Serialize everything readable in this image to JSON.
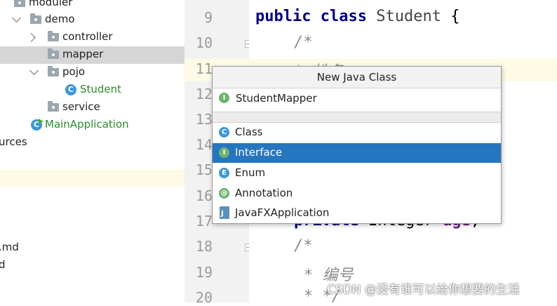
{
  "tree": {
    "items": [
      {
        "label": "moduler",
        "level": 1
      },
      {
        "label": "demo",
        "level": 2
      },
      {
        "label": "controller",
        "level": 3
      },
      {
        "label": "mapper",
        "level": 3
      },
      {
        "label": "pojo",
        "level": 3
      },
      {
        "label": "Student",
        "level": 4
      },
      {
        "label": "service",
        "level": 3
      },
      {
        "label": "MainApplication",
        "level": 2
      },
      {
        "label": "urces",
        "level": 0
      },
      {
        "label": ".md",
        "level": 0
      },
      {
        "label": "d",
        "level": 0
      }
    ],
    "selected": "mapper"
  },
  "gutter": {
    "line_numbers": [
      "9",
      "10",
      "11",
      "12",
      "13",
      "14",
      "15",
      "16",
      "17",
      "18",
      "19",
      "20"
    ]
  },
  "editor": {
    "line9": {
      "kw1": "public",
      "kw2": "class",
      "name": "Student",
      "brace": "{"
    },
    "line10": "/*",
    "line11": "* 姓名",
    "line17": {
      "kw": "private",
      "type": "Integer",
      "field": "age",
      "end": ";"
    },
    "line18": "/*",
    "line19": "* 编号",
    "line20": "* */"
  },
  "popup": {
    "title": "New Java Class",
    "name_value": "StudentMapper",
    "options": [
      {
        "label": "Class",
        "icon": "class-icon",
        "badge": "C"
      },
      {
        "label": "Interface",
        "icon": "interface-icon",
        "badge": "I"
      },
      {
        "label": "Enum",
        "icon": "enum-icon",
        "badge": "E"
      },
      {
        "label": "Annotation",
        "icon": "annotation-icon",
        "badge": "@"
      },
      {
        "label": "JavaFXApplication",
        "icon": "javafx-icon",
        "badge": ""
      }
    ],
    "selected": "Interface",
    "colors": {
      "selection": "#2675bf"
    }
  },
  "watermark": "CSDN @没有谁可以给你想要的生活"
}
